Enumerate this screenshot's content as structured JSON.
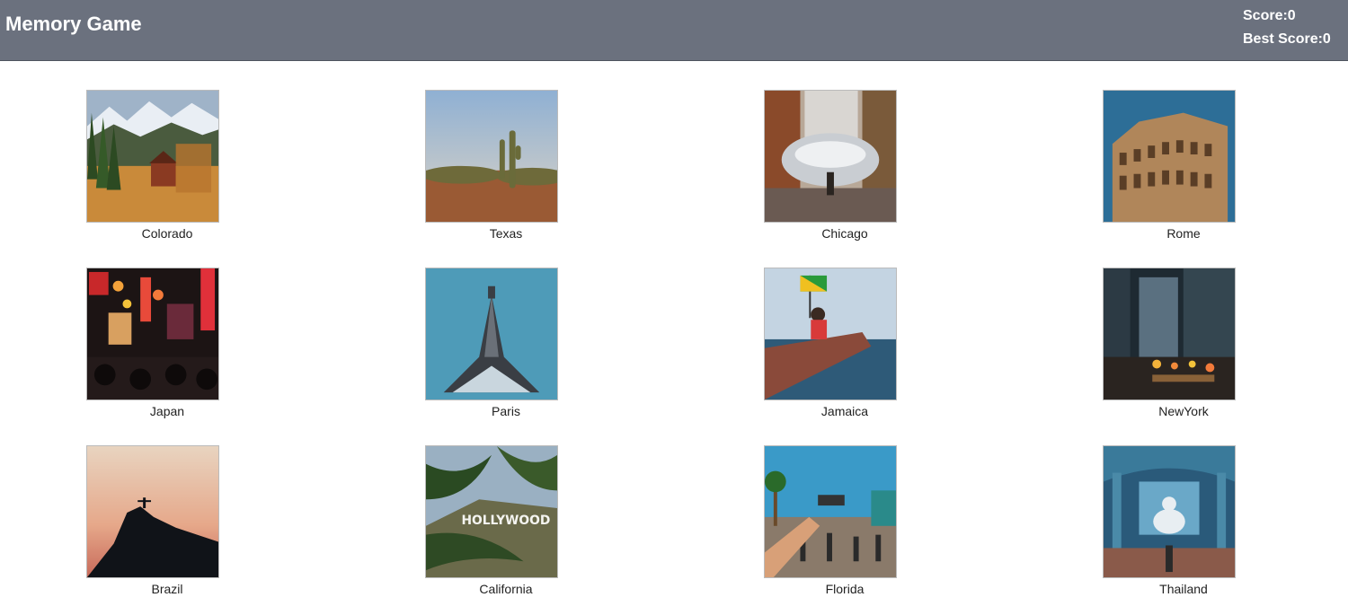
{
  "header": {
    "title": "Memory Game",
    "score_text": "Score:0",
    "best_score_text": "Best Score:0"
  },
  "cards": [
    {
      "label": "Colorado",
      "image": "mountain-cabin-landscape"
    },
    {
      "label": "Texas",
      "image": "desert-cactus-landscape"
    },
    {
      "label": "Chicago",
      "image": "cloud-gate-bean"
    },
    {
      "label": "Rome",
      "image": "colosseum"
    },
    {
      "label": "Japan",
      "image": "neon-street-signs"
    },
    {
      "label": "Paris",
      "image": "eiffel-tower"
    },
    {
      "label": "Jamaica",
      "image": "boat-with-flag"
    },
    {
      "label": "NewYork",
      "image": "city-street-night"
    },
    {
      "label": "Brazil",
      "image": "christ-redeemer-silhouette"
    },
    {
      "label": "California",
      "image": "hollywood-sign-palms"
    },
    {
      "label": "Florida",
      "image": "beach-street-crowd"
    },
    {
      "label": "Thailand",
      "image": "temple-buddha-interior"
    }
  ]
}
